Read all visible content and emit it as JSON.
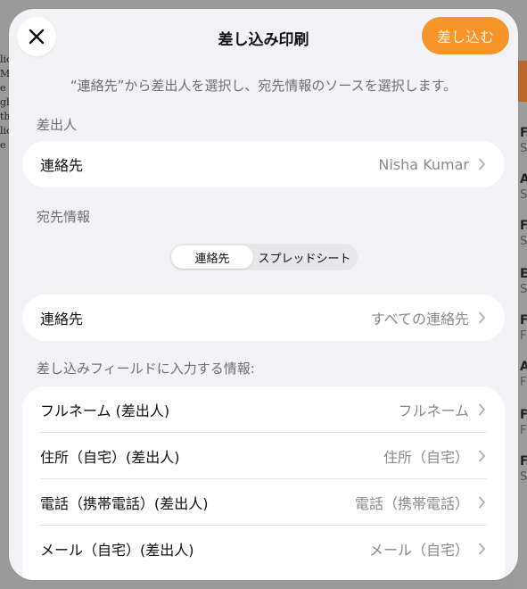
{
  "background": {
    "left_fragments": [
      "lic",
      "M",
      "e t",
      "gh",
      "th",
      "lic",
      "e"
    ],
    "right_rows": [
      {
        "letter": "F",
        "sub": "S"
      },
      {
        "letter": "A",
        "sub": "S"
      },
      {
        "letter": "F",
        "sub": "S"
      },
      {
        "letter": "E",
        "sub": "S"
      },
      {
        "letter": "F",
        "sub": "F"
      },
      {
        "letter": "A",
        "sub": "F"
      },
      {
        "letter": "F",
        "sub": "F"
      },
      {
        "letter": "F",
        "sub": "S"
      }
    ]
  },
  "header": {
    "title": "差し込み印刷",
    "merge_button": "差し込む",
    "close_icon": "close-icon"
  },
  "instructions": "“連絡先”から差出人を選択し、宛先情報のソースを選択します。",
  "sender": {
    "section_label": "差出人",
    "row": {
      "label": "連絡先",
      "value": "Nisha Kumar"
    }
  },
  "recipient": {
    "section_label": "宛先情報",
    "segments": [
      "連絡先",
      "スプレッドシート"
    ],
    "selected_segment": "連絡先",
    "row": {
      "label": "連絡先",
      "value": "すべての連絡先"
    }
  },
  "fields": {
    "section_label": "差し込みフィールドに入力する情報:",
    "rows": [
      {
        "label": "フルネーム (差出人)",
        "value": "フルネーム"
      },
      {
        "label": "住所（自宅）(差出人)",
        "value": "住所（自宅）"
      },
      {
        "label": "電話（携帯電話）(差出人)",
        "value": "電話（携帯電話）"
      },
      {
        "label": "メール（自宅）(差出人)",
        "value": "メール（自宅）"
      }
    ]
  },
  "colors": {
    "accent": "#f7942a",
    "sheet_bg": "#f2f2f7",
    "secondary_text": "#8a8a8e"
  }
}
